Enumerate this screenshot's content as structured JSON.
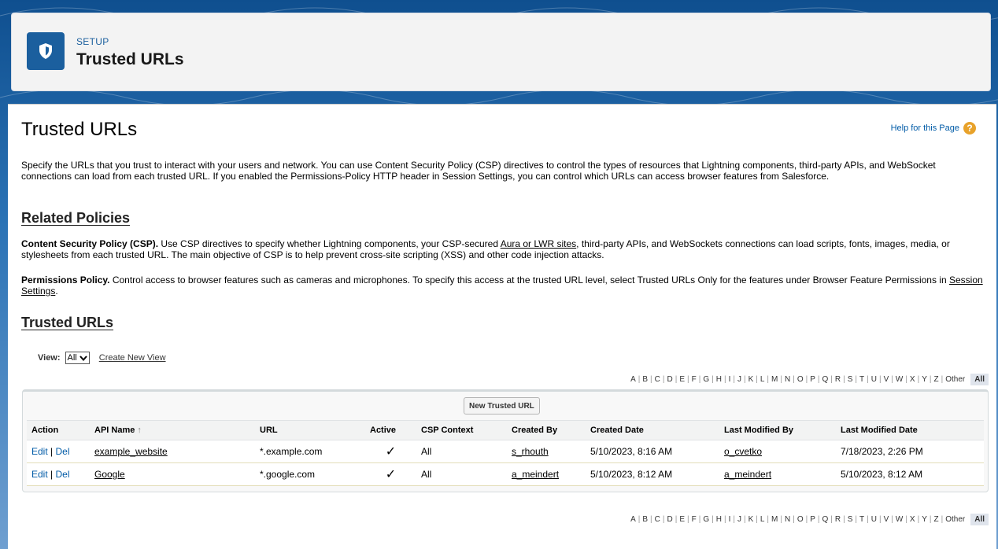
{
  "header": {
    "eyebrow": "SETUP",
    "title": "Trusted URLs",
    "icon": "shield-icon"
  },
  "page": {
    "title": "Trusted URLs",
    "help_link": "Help for this Page",
    "intro": "Specify the URLs that you trust to interact with your users and network. You can use Content Security Policy (CSP) directives to control the types of resources that Lightning components, third-party APIs, and WebSocket connections can load from each trusted URL. If you enabled the Permissions-Policy HTTP header in Session Settings, you can control which URLs can access browser features from Salesforce."
  },
  "related": {
    "heading": "Related Policies",
    "csp_label": "Content Security Policy (CSP).",
    "csp_text_a": " Use CSP directives to specify whether Lightning components, your CSP-secured ",
    "csp_link": "Aura or LWR sites",
    "csp_text_b": ", third-party APIs, and WebSockets connections can load scripts, fonts, images, media, or stylesheets from each trusted URL. The main objective of CSP is to help prevent cross-site scripting (XSS) and other code injection attacks.",
    "perm_label": "Permissions Policy.",
    "perm_text_a": " Control access to browser features such as cameras and microphones. To specify this access at the trusted URL level, select Trusted URLs Only for the features under Browser Feature Permissions in ",
    "perm_link": "Session Settings",
    "perm_text_b": "."
  },
  "list": {
    "heading": "Trusted URLs",
    "view_label": "View:",
    "view_value": "All",
    "create_view": "Create New View",
    "new_button": "New Trusted URL",
    "alphabet": [
      "A",
      "B",
      "C",
      "D",
      "E",
      "F",
      "G",
      "H",
      "I",
      "J",
      "K",
      "L",
      "M",
      "N",
      "O",
      "P",
      "Q",
      "R",
      "S",
      "T",
      "U",
      "V",
      "W",
      "X",
      "Y",
      "Z",
      "Other"
    ],
    "alpha_all": "All",
    "columns": [
      "Action",
      "API Name",
      "URL",
      "Active",
      "CSP Context",
      "Created By",
      "Created Date",
      "Last Modified By",
      "Last Modified Date"
    ],
    "sort_indicator": "↑",
    "edit_label": "Edit",
    "del_label": "Del",
    "rows": [
      {
        "api_name": "example_website",
        "url": "*.example.com",
        "active": "✓",
        "csp_context": "All",
        "created_by": "s_rhouth",
        "created_date": "5/10/2023, 8:16 AM",
        "modified_by": "o_cvetko",
        "modified_date": "7/18/2023, 2:26 PM"
      },
      {
        "api_name": "Google",
        "url": "*.google.com",
        "active": "✓",
        "csp_context": "All",
        "created_by": "a_meindert",
        "created_date": "5/10/2023, 8:12 AM",
        "modified_by": "a_meindert",
        "modified_date": "5/10/2023, 8:12 AM"
      }
    ]
  }
}
